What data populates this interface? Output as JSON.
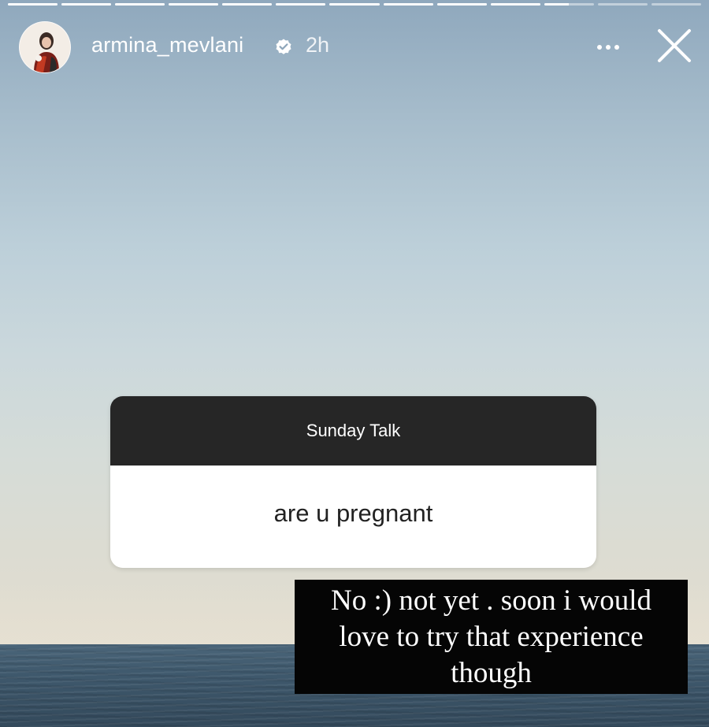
{
  "story": {
    "progress_segments": 13,
    "current_segment": 11
  },
  "header": {
    "username": "armina_mevlani",
    "verified": true,
    "timestamp": "2h",
    "more_icon": "more-horizontal-icon",
    "close_icon": "close-icon"
  },
  "question_sticker": {
    "title": "Sunday Talk",
    "question": "are u pregnant"
  },
  "answer": {
    "text": "No :) not yet . soon i would love to try that experience though"
  },
  "colors": {
    "sticker_header": "#262626",
    "sticker_body": "#ffffff",
    "caption_background": "#050505",
    "caption_text": "#ffffff"
  }
}
